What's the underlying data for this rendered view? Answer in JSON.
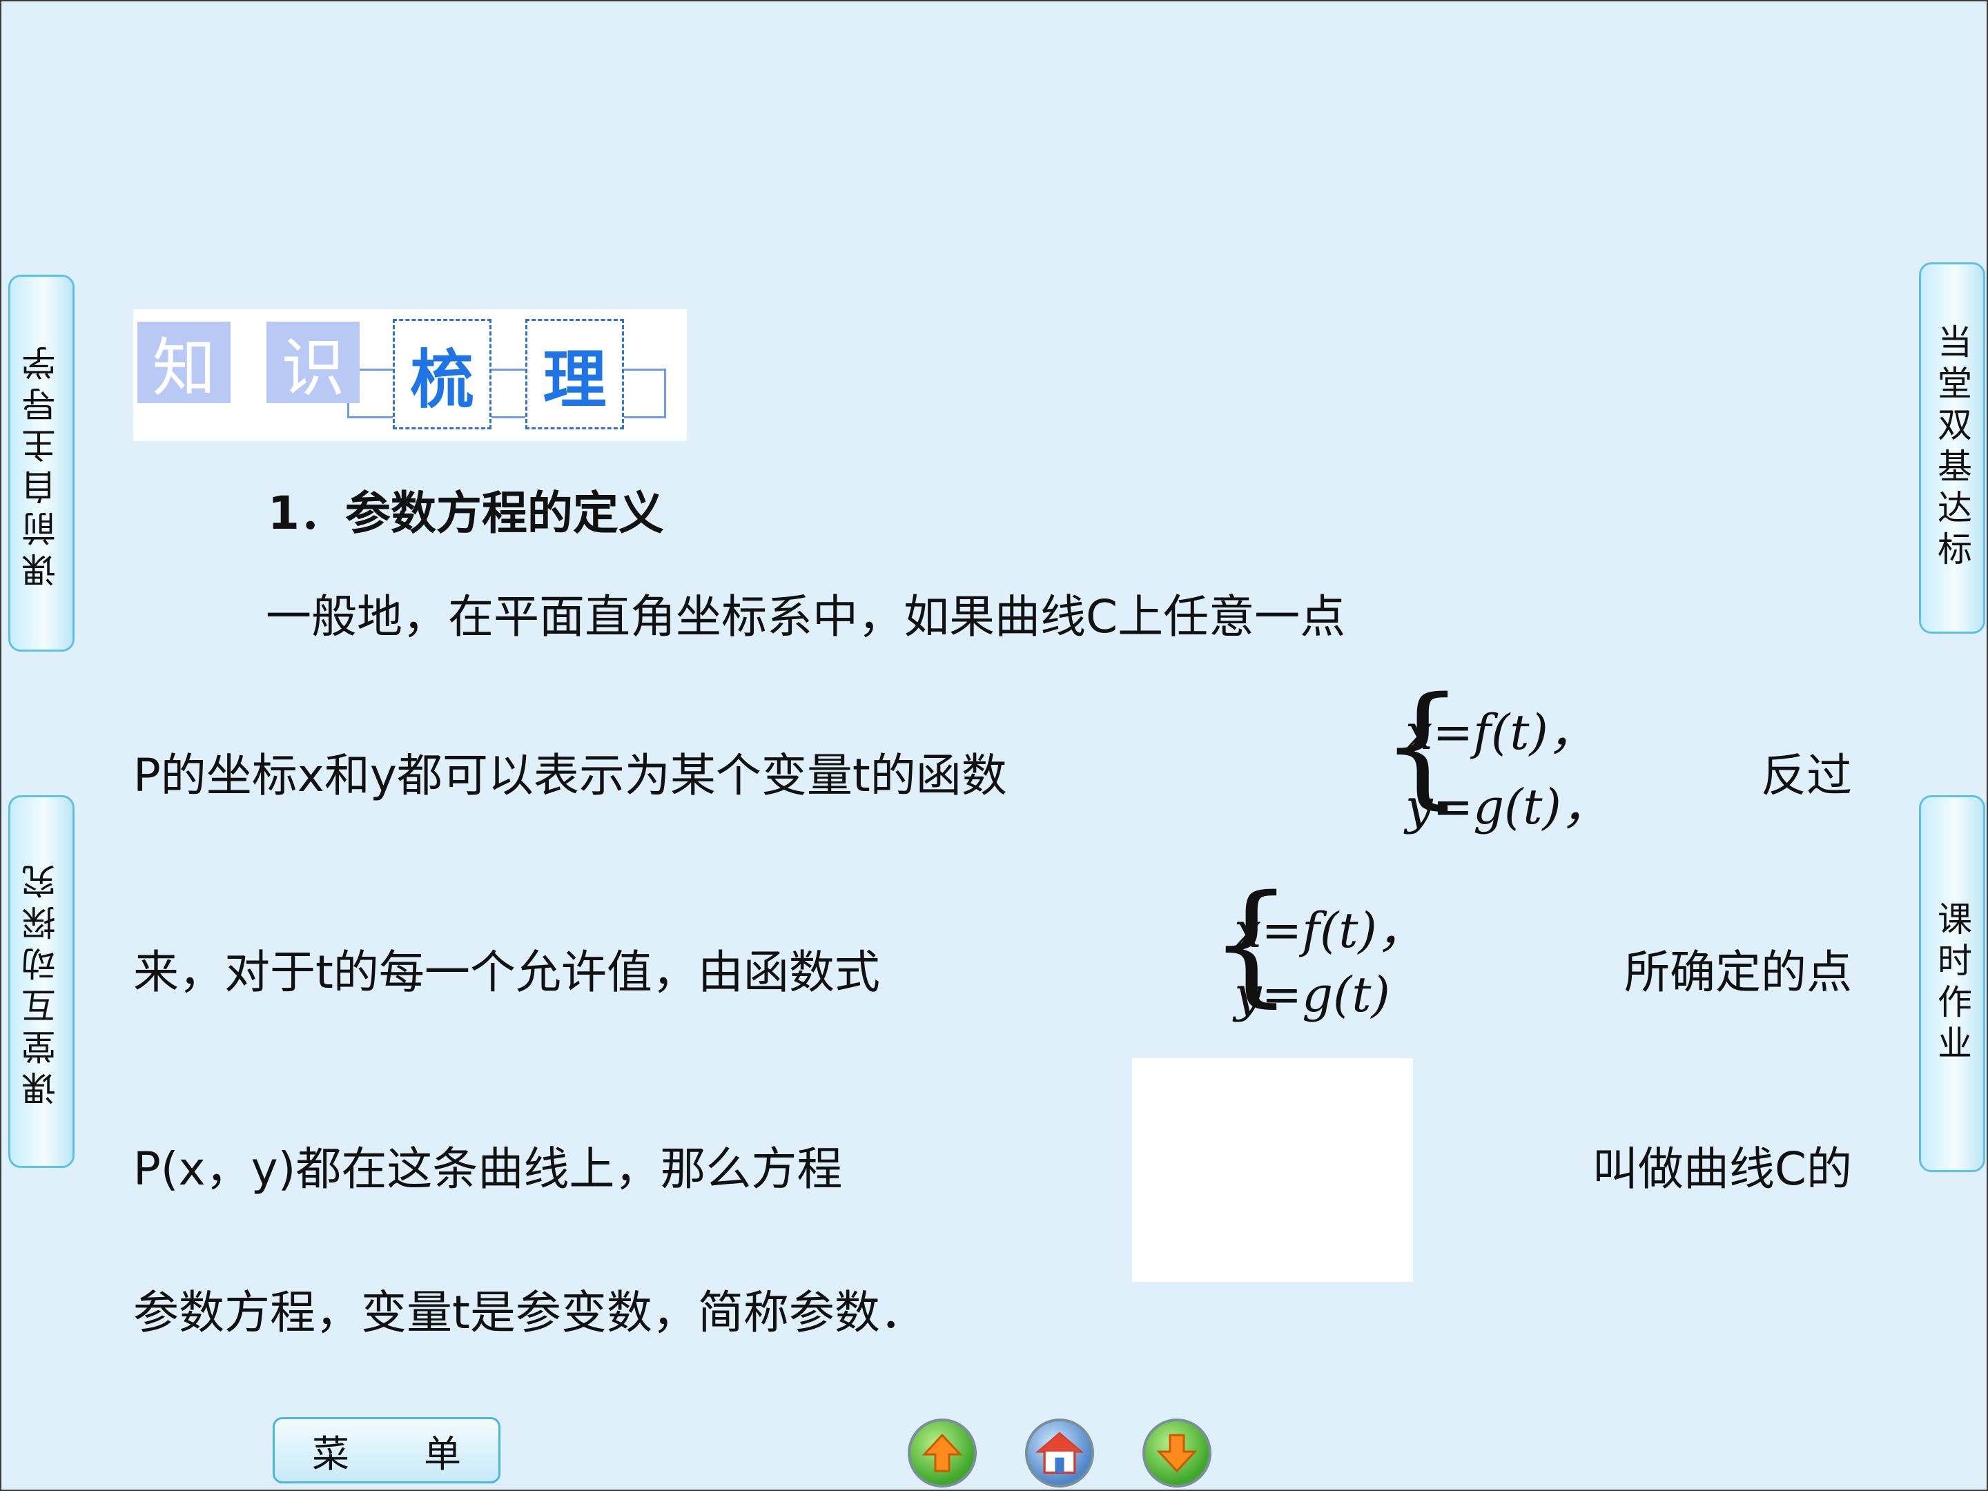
{
  "side_tabs": {
    "left_top": "课前自主导学",
    "left_bottom": "课堂互动探究",
    "right_top": "当堂双基达标",
    "right_bottom": "课时作业"
  },
  "header": {
    "chars": [
      "知",
      "识",
      "梳",
      "理"
    ]
  },
  "section": {
    "heading": "1．参数方程的定义",
    "line1": "一般地，在平面直角坐标系中，如果曲线C上任意一点",
    "line2_a": "P的坐标x和y都可以表示为某个变量t的函数",
    "line2_b": "反过",
    "line3_a": "来，对于t的每一个允许值，由函数式",
    "line3_b": "所确定的点",
    "line4_a": "P(x，y)都在这条曲线上，那么方程",
    "line4_b": "叫做曲线C的",
    "line5": "参数方程，变量t是参变数，简称参数．"
  },
  "system1": {
    "eq1": "x=f(t)，",
    "eq2": "y=g(t)，"
  },
  "system2": {
    "eq1": "x=f(t)，",
    "eq2": "y=g(t)"
  },
  "nav": {
    "menu_label_1": "菜",
    "menu_label_2": "单",
    "prev_icon": "arrow-up-icon",
    "home_icon": "home-icon",
    "next_icon": "arrow-down-icon"
  }
}
